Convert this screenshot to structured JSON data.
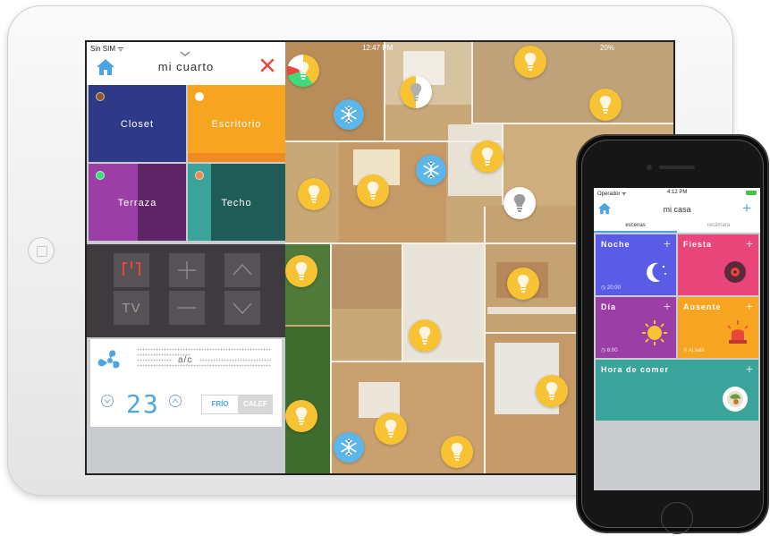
{
  "ipad": {
    "status_left": "Sin SIM ᯤ",
    "status_time": "12:47 PM",
    "status_right": "20%",
    "room_title": "mi cuarto",
    "tiles": [
      {
        "label": "Closet",
        "color": "#2e3a87",
        "dot": "#8b5a2b"
      },
      {
        "label": "Escritorio",
        "color": "#f7a421",
        "dot": "#ffffff"
      },
      {
        "label": "Terraza",
        "color": "#9b3fa6",
        "dot": "#3ddc7a"
      },
      {
        "label": "Techo",
        "color": "#3aa39a",
        "dot": "#f08a4b"
      }
    ],
    "remote": {
      "tv_label": "TV"
    },
    "ac": {
      "label": "a/c",
      "temperature": "23",
      "mode_cool": "FRÍO",
      "mode_heat": "CALEF"
    }
  },
  "iphone": {
    "carrier": "Operador ᯤ",
    "time": "4:12 PM",
    "title": "mi casa",
    "tabs": [
      {
        "label": "escenas",
        "active": true
      },
      {
        "label": "recámara",
        "active": false
      }
    ],
    "scenes": [
      {
        "label": "Noche",
        "sub": "◷ 20:00",
        "color": "#5a5ce6"
      },
      {
        "label": "Fiesta",
        "sub": "",
        "color": "#e8457b"
      },
      {
        "label": "Día",
        "sub": "◷ 6:00",
        "color": "#9b3fa6"
      },
      {
        "label": "Ausente",
        "sub": "⚲ Al salir",
        "color": "#f7a421"
      },
      {
        "label": "Hora de comer",
        "sub": "",
        "color": "#3aa39a"
      }
    ]
  },
  "colors": {
    "accent_blue": "#4aa6e0",
    "close_red": "#e8453c",
    "bulb_yellow": "#f7c234",
    "snow_blue": "#5bb6ea"
  }
}
